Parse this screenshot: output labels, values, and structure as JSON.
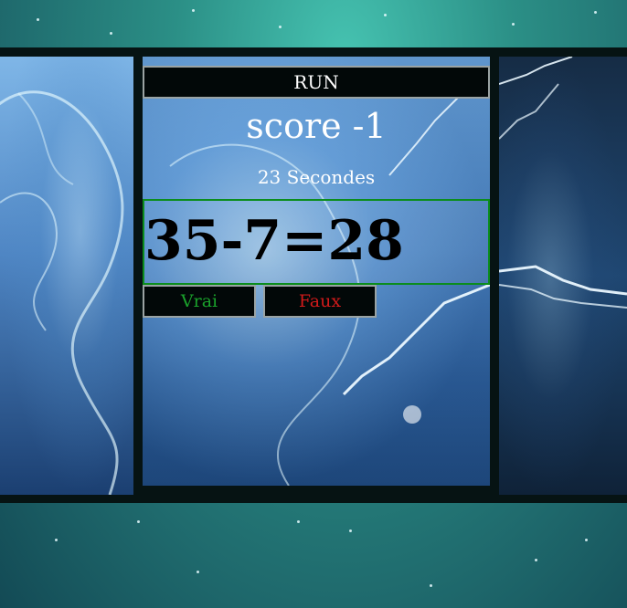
{
  "game": {
    "run_label": "RUN",
    "score_text": "score -1",
    "timer_text": "23 Secondes",
    "equation_text": "35-7=28",
    "vrai_label": "Vrai",
    "faux_label": "Faux"
  },
  "colors": {
    "vrai": "#1aa12b",
    "faux": "#d01a1a",
    "equation_border": "#0b8d1d",
    "background_teal": "#2b8f86"
  }
}
